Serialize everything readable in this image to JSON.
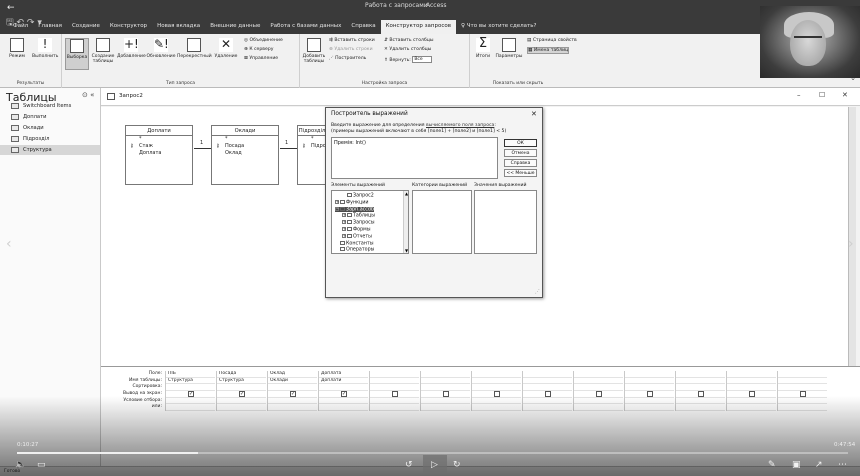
{
  "titlebar": {
    "context_tab": "Работа с запросами",
    "app_name": "Access"
  },
  "ribbon_tabs": [
    "Файл",
    "Главная",
    "Создание",
    "Конструктор",
    "Новая вкладка",
    "Внешние данные",
    "Работа с базами данных",
    "Справка",
    "Конструктор запросов"
  ],
  "active_tab_index": 8,
  "tell_me": "Что вы хотите сделать?",
  "ribbon": {
    "results_group": "Результаты",
    "query_type_group": "Тип запроса",
    "setup_group": "Настройка запроса",
    "showhide_group": "Показать или скрыть",
    "mode": "Режим",
    "run": "Выполнить",
    "select": "Выборка",
    "make_table": "Создание таблицы",
    "append": "Добавление",
    "update": "Обновление",
    "crosstab": "Перекрестный",
    "delete": "Удаление",
    "union": "Объединение",
    "pass_through": "К серверу",
    "ddl": "Управление",
    "add_tables": "Добавить таблицы",
    "insert_rows": "Вставить строки",
    "delete_rows": "Удалить строки",
    "builder": "Построитель",
    "insert_cols": "Вставить столбцы",
    "delete_cols": "Удалить столбцы",
    "return_label": "Вернуть:",
    "return_value": "Все",
    "totals": "Итоги",
    "parameters": "Параметры",
    "property_sheet": "Страница свойств",
    "table_names": "Имена таблиц"
  },
  "nav": {
    "title": "Таблицы",
    "items": [
      "Switchboard Items",
      "Доплати",
      "Оклади",
      "Підрозділ",
      "Структура"
    ],
    "selected_index": 4
  },
  "document": {
    "tab_label": "Запрос2",
    "tables": [
      {
        "name": "Доплати",
        "fields": [
          "*",
          "Стаж",
          "Доплата"
        ]
      },
      {
        "name": "Оклади",
        "fields": [
          "*",
          "Посада",
          "Оклад"
        ]
      },
      {
        "name": "Підрозділ",
        "fields": [
          "*",
          "Підрозд"
        ]
      }
    ],
    "relation_label": "1"
  },
  "qbe": {
    "row_labels": [
      "Поле:",
      "Имя таблицы:",
      "Сортировка:",
      "Вывод на экран:",
      "Условие отбора:",
      "или:"
    ],
    "columns": [
      {
        "field": "ПІБ",
        "table": "Структура",
        "show": true
      },
      {
        "field": "Посада",
        "table": "Структура",
        "show": true
      },
      {
        "field": "Оклад",
        "table": "Оклади",
        "show": true
      },
      {
        "field": "Доплата",
        "table": "Доплати",
        "show": true
      },
      {
        "field": "",
        "table": "",
        "show": false
      },
      {
        "field": "",
        "table": "",
        "show": false
      },
      {
        "field": "",
        "table": "",
        "show": false
      },
      {
        "field": "",
        "table": "",
        "show": false
      },
      {
        "field": "",
        "table": "",
        "show": false
      },
      {
        "field": "",
        "table": "",
        "show": false
      },
      {
        "field": "",
        "table": "",
        "show": false
      },
      {
        "field": "",
        "table": "",
        "show": false
      },
      {
        "field": "",
        "table": "",
        "show": false
      }
    ]
  },
  "dialog": {
    "title": "Построитель выражений",
    "hint_prefix": "Введите выражение для определения",
    "hint_link": "вычисляемого поля запроса",
    "hint_line2": "(примеры выражений включают в себя [поле1] + [поле2] и [поле1] < 5)",
    "expression": "Премія: Int()",
    "buttons": {
      "ok": "ОК",
      "cancel": "Отмена",
      "help": "Справка",
      "less": "<< Меньше"
    },
    "pane_labels": {
      "elements": "Элементы выражений",
      "categories": "Категории выражений",
      "values": "Значения выражений"
    },
    "tree": [
      {
        "label": "Запрос2",
        "box": "",
        "indent": 1
      },
      {
        "label": "Функции",
        "box": "+",
        "indent": 0
      },
      {
        "label": "Зарп.accdb",
        "box": "−",
        "indent": 0,
        "selected": true
      },
      {
        "label": "Таблицы",
        "box": "+",
        "indent": 1
      },
      {
        "label": "Запросы",
        "box": "+",
        "indent": 1
      },
      {
        "label": "Формы",
        "box": "+",
        "indent": 1
      },
      {
        "label": "Отчеты",
        "box": "+",
        "indent": 1
      },
      {
        "label": "Константы",
        "box": "",
        "indent": 0
      },
      {
        "label": "Операторы",
        "box": "",
        "indent": 0
      }
    ]
  },
  "status": {
    "text": "Готово"
  },
  "player": {
    "elapsed": "0:10:27",
    "total": "0:47:54",
    "progress_percent": 21.8
  }
}
